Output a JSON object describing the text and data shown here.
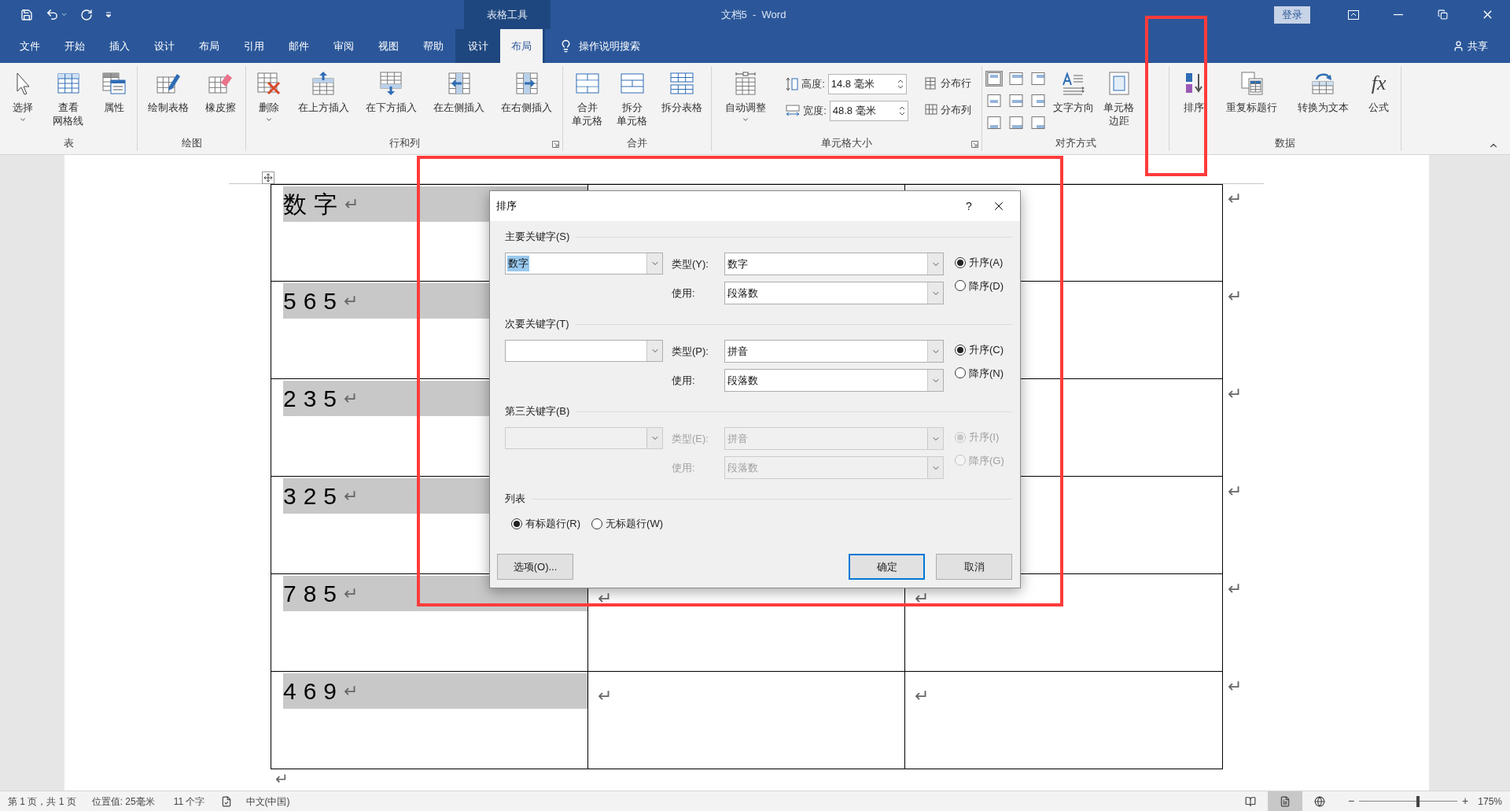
{
  "title_bar": {
    "context_label": "表格工具",
    "title": "文档5  -  Word",
    "sign_in": "登录"
  },
  "tabs": [
    {
      "label": "文件",
      "selected": false,
      "context": false
    },
    {
      "label": "开始",
      "selected": false,
      "context": false
    },
    {
      "label": "插入",
      "selected": false,
      "context": false
    },
    {
      "label": "设计",
      "selected": false,
      "context": false
    },
    {
      "label": "布局",
      "selected": false,
      "context": false
    },
    {
      "label": "引用",
      "selected": false,
      "context": false
    },
    {
      "label": "邮件",
      "selected": false,
      "context": false
    },
    {
      "label": "审阅",
      "selected": false,
      "context": false
    },
    {
      "label": "视图",
      "selected": false,
      "context": false
    },
    {
      "label": "帮助",
      "selected": false,
      "context": false
    },
    {
      "label": "设计",
      "selected": false,
      "context": true
    },
    {
      "label": "布局",
      "selected": true,
      "context": true
    }
  ],
  "tell_me": "操作说明搜索",
  "share": "共享",
  "ribbon": {
    "groups": [
      {
        "label": "表",
        "launcher": false,
        "items": [
          {
            "kind": "big",
            "lines": [
              "选择"
            ],
            "dropdown": true
          },
          {
            "kind": "big",
            "lines": [
              "查看",
              "网格线"
            ],
            "dropdown": false
          },
          {
            "kind": "big",
            "lines": [
              "属性"
            ],
            "dropdown": false
          }
        ]
      },
      {
        "label": "绘图",
        "launcher": false,
        "items": [
          {
            "kind": "big",
            "lines": [
              "绘制表格"
            ],
            "dropdown": false
          },
          {
            "kind": "big",
            "lines": [
              "橡皮擦"
            ],
            "dropdown": false
          }
        ]
      },
      {
        "label": "行和列",
        "launcher": true,
        "items": [
          {
            "kind": "big",
            "lines": [
              "删除"
            ],
            "dropdown": true
          },
          {
            "kind": "big",
            "lines": [
              "在上方插入"
            ],
            "dropdown": false
          },
          {
            "kind": "big",
            "lines": [
              "在下方插入"
            ],
            "dropdown": false
          },
          {
            "kind": "big",
            "lines": [
              "在左侧插入"
            ],
            "dropdown": false
          },
          {
            "kind": "big",
            "lines": [
              "在右侧插入"
            ],
            "dropdown": false
          }
        ]
      },
      {
        "label": "合并",
        "launcher": false,
        "items": [
          {
            "kind": "big",
            "lines": [
              "合并",
              "单元格"
            ],
            "dropdown": false
          },
          {
            "kind": "big",
            "lines": [
              "拆分",
              "单元格"
            ],
            "dropdown": false
          },
          {
            "kind": "big",
            "lines": [
              "拆分表格"
            ],
            "dropdown": false
          }
        ]
      },
      {
        "label": "单元格大小",
        "launcher": true,
        "items": [
          {
            "kind": "big",
            "lines": [
              "自动调整"
            ],
            "dropdown": true
          },
          {
            "kind": "fields",
            "fields": [
              {
                "label": "高度:",
                "value": "14.8 毫米"
              },
              {
                "label": "宽度:",
                "value": "48.8 毫米"
              }
            ]
          },
          {
            "kind": "stack",
            "buttons": [
              {
                "label": "分布行"
              },
              {
                "label": "分布列"
              }
            ]
          }
        ]
      },
      {
        "label": "对齐方式",
        "launcher": false,
        "items": [
          {
            "kind": "align",
            "buttons": [
              {
                "selected": true
              },
              {
                "selected": false
              },
              {
                "selected": false
              },
              {
                "selected": false
              },
              {
                "selected": false
              },
              {
                "selected": false
              },
              {
                "selected": false
              },
              {
                "selected": false
              },
              {
                "selected": false
              }
            ]
          },
          {
            "kind": "big",
            "lines": [
              "文字方向"
            ],
            "dropdown": false
          },
          {
            "kind": "big",
            "lines": [
              "单元格",
              "边距"
            ],
            "dropdown": false
          }
        ]
      },
      {
        "label": "数据",
        "launcher": false,
        "items": [
          {
            "kind": "big",
            "lines": [
              "排序"
            ],
            "dropdown": false,
            "highlighted": true
          },
          {
            "kind": "big",
            "lines": [
              "重复标题行"
            ],
            "dropdown": false
          },
          {
            "kind": "big",
            "lines": [
              "转换为文本"
            ],
            "dropdown": false
          },
          {
            "kind": "big",
            "icon_text": "fx",
            "lines": [
              "公式"
            ],
            "dropdown": false
          }
        ]
      }
    ]
  },
  "table": {
    "rows": [
      {
        "label": "数字",
        "mark": "↵",
        "cells": [],
        "end": "↵"
      },
      {
        "label": "565",
        "mark": "↵",
        "cells": [],
        "end": "↵"
      },
      {
        "label": "235",
        "mark": "↵",
        "cells": [],
        "end": "↵"
      },
      {
        "label": "325",
        "mark": "↵",
        "cells": [],
        "end": "↵"
      },
      {
        "label": "785",
        "mark": "↵",
        "cells": [
          "↵",
          "↵"
        ],
        "end": "↵"
      },
      {
        "label": "469",
        "mark": "↵",
        "cells": [
          "↵",
          "↵"
        ],
        "end": "↵"
      }
    ],
    "final_mark": "↵"
  },
  "dialog": {
    "title": "排序",
    "help": "?",
    "highlighted": true,
    "sections": [
      {
        "heading": "主要关键字(S)",
        "key_value": "数字",
        "highlighted": true,
        "type_label": "类型(Y):",
        "type_value": "数字",
        "use_label": "使用:",
        "use_value": "段落数",
        "disabled": false,
        "order": [
          {
            "label": "升序(A)",
            "selected": true
          },
          {
            "label": "降序(D)",
            "selected": false
          }
        ]
      },
      {
        "heading": "次要关键字(T)",
        "highlighted": false,
        "type_label": "类型(P):",
        "type_value": "拼音",
        "use_label": "使用:",
        "use_value": "段落数",
        "disabled": false,
        "order": [
          {
            "label": "升序(C)",
            "selected": true
          },
          {
            "label": "降序(N)",
            "selected": false
          }
        ]
      },
      {
        "heading": "第三关键字(B)",
        "highlighted": false,
        "type_label": "类型(E):",
        "type_value": "拼音",
        "use_label": "使用:",
        "use_value": "段落数",
        "disabled": true,
        "order": [
          {
            "label": "升序(I)",
            "selected": true
          },
          {
            "label": "降序(G)",
            "selected": false
          }
        ]
      }
    ],
    "list": {
      "heading": "列表",
      "options": [
        {
          "label": "有标题行(R)",
          "selected": true
        },
        {
          "label": "无标题行(W)",
          "selected": false
        }
      ]
    },
    "buttons": [
      {
        "label": "选项(O)...",
        "default": false
      },
      {
        "label": "确定",
        "default": true
      },
      {
        "label": "取消",
        "default": false
      }
    ]
  },
  "status_bar": {
    "page": "第 1 页，共 1 页",
    "position": "位置值: 25毫米",
    "words": "11 个字",
    "language": "中文(中国)",
    "views": [
      {
        "selected": false
      },
      {
        "selected": true
      },
      {
        "selected": false
      }
    ],
    "zoom": {
      "minus": "−",
      "plus": "+",
      "level": 0.6,
      "reading": "175%"
    }
  }
}
